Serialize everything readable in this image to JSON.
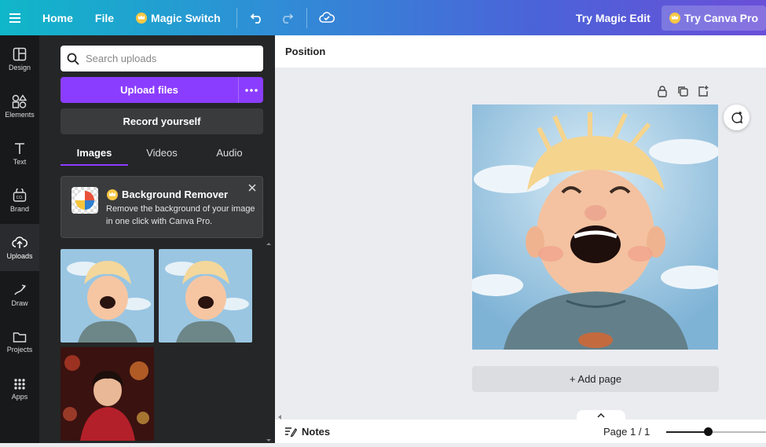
{
  "topbar": {
    "home": "Home",
    "file": "File",
    "magic_switch": "Magic Switch",
    "try_magic_edit": "Try Magic Edit",
    "try_canva_pro": "Try Canva Pro"
  },
  "rail": [
    {
      "label": "Design"
    },
    {
      "label": "Elements"
    },
    {
      "label": "Text"
    },
    {
      "label": "Brand"
    },
    {
      "label": "Uploads"
    },
    {
      "label": "Draw"
    },
    {
      "label": "Projects"
    },
    {
      "label": "Apps"
    }
  ],
  "panel": {
    "search_placeholder": "Search uploads",
    "upload_label": "Upload files",
    "record_label": "Record yourself",
    "tabs": [
      "Images",
      "Videos",
      "Audio"
    ],
    "active_tab": "Images",
    "bg_remover": {
      "title": "Background Remover",
      "desc": "Remove the background of your image in one click with Canva Pro."
    }
  },
  "canvas": {
    "position_label": "Position",
    "add_page": "+ Add page"
  },
  "footer": {
    "notes": "Notes",
    "page_indicator": "Page 1 / 1"
  },
  "colors": {
    "accent": "#8b3dff",
    "panel_bg": "#252627",
    "rail_bg": "#18191b"
  }
}
